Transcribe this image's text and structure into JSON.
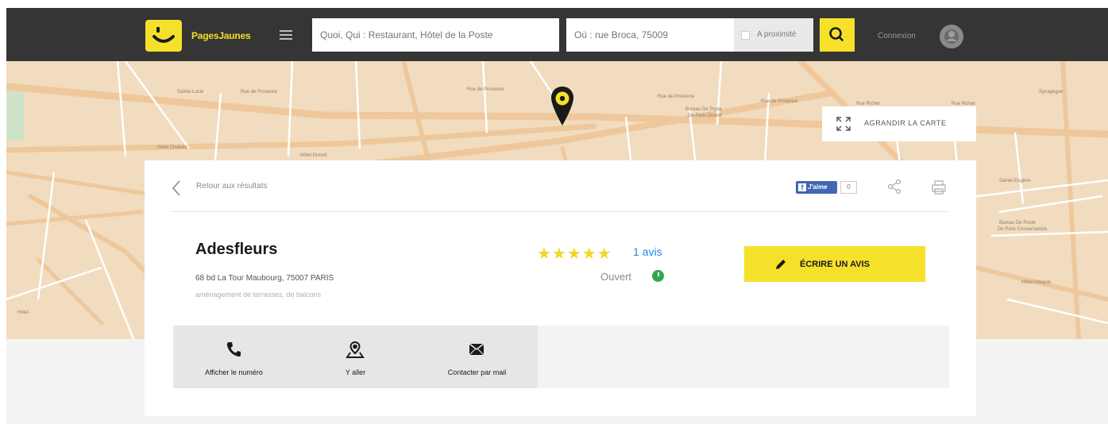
{
  "header": {
    "brand": "PagesJaunes",
    "search_what_placeholder": "Quoi, Qui : Restaurant, Hôtel de la Poste",
    "search_where_placeholder": "Où : rue Broca, 75009",
    "proximity_label": "A proximité",
    "connexion_label": "Connexion"
  },
  "map": {
    "enlarge_label": "AGRANDIR LA CARTE",
    "street_labels": [
      "Rue de Provence",
      "Rue de Provence",
      "Rue de Provence",
      "Rue de Provence",
      "Rue Richer",
      "Rue Richer",
      "Rue La Fayette",
      "Bureau De Poste De Paris Drouot",
      "Sainte-Eugène",
      "Synagogue",
      "Bureau De Poste De Paris Conservatoire",
      "Bureau De Poste De Paris",
      "Hôtel Chatelet",
      "Haussmann"
    ]
  },
  "card": {
    "back_label": "Retour aux résultats",
    "fb_label": "J'aime",
    "fb_count": "0",
    "business": {
      "name": "Adesfleurs",
      "address": "68 bd La Tour Maubourg, 75007 PARIS",
      "activity": "aménagement de terrasses, de balcons",
      "rating_stars": 5,
      "stars_text": "★★★★★",
      "reviews_label": "1 avis",
      "status_label": "Ouvert"
    },
    "write_review_label": "ÉCRIRE UN AVIS",
    "actions": [
      {
        "label": "Afficher le numéro",
        "icon": "phone-icon"
      },
      {
        "label": "Y aller",
        "icon": "directions-icon"
      },
      {
        "label": "Contacter par mail",
        "icon": "mail-icon"
      }
    ]
  },
  "colors": {
    "brand_yellow": "#f5e12a",
    "topbar": "#353535",
    "map_bg": "#f2dcbf",
    "link_blue": "#1e88e5",
    "open_green": "#2fa84f"
  }
}
